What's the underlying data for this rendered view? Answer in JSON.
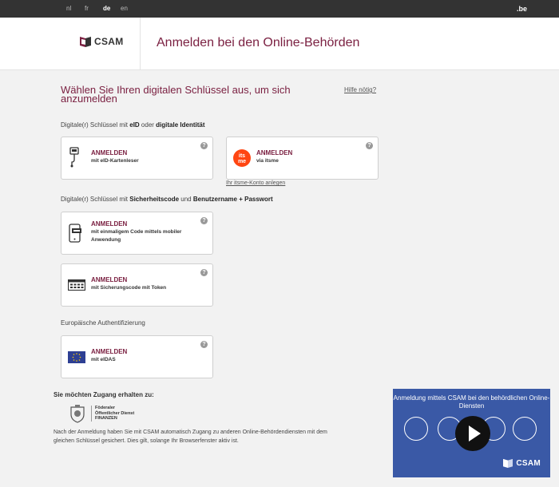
{
  "languages": [
    {
      "code": "nl",
      "active": false
    },
    {
      "code": "fr",
      "active": false
    },
    {
      "code": "de",
      "active": true
    },
    {
      "code": "en",
      "active": false
    }
  ],
  "domain_label": ".be",
  "header": {
    "logo_text": "CSAM",
    "title": "Anmelden bei den Online-Behörden"
  },
  "main": {
    "title": "Wählen Sie Ihren digitalen Schlüssel aus, um sich anzumelden",
    "help_link": "Hilfe nötig?"
  },
  "sections": {
    "s1": {
      "prefix": "Digitale(r) Schlüssel mit ",
      "b1": "eID",
      "mid": " oder ",
      "b2": "digitale Identität"
    },
    "s2": {
      "prefix": "Digitale(r) Schlüssel mit ",
      "b1": "Sicherheitscode",
      "mid": " und ",
      "b2": "Benutzername + Passwort"
    },
    "s3": {
      "label": "Europäische Authentifizierung"
    }
  },
  "cards": {
    "eid": {
      "title": "ANMELDEN",
      "subtitle": "mit eID-Kartenleser",
      "help": "?"
    },
    "itsme": {
      "title": "ANMELDEN",
      "subtitle": "via itsme",
      "help": "?",
      "badge_line1": "its",
      "badge_line2": "me"
    },
    "mobile": {
      "title": "ANMELDEN",
      "subtitle": "mit einmaligem Code mittels mobiler Anwendung",
      "help": "?"
    },
    "token": {
      "title": "ANMELDEN",
      "subtitle": "mit Sicherungscode mit Token",
      "help": "?"
    },
    "eidas": {
      "title": "ANMELDEN",
      "subtitle": "mit eIDAS",
      "help": "?"
    }
  },
  "itsme_link": "Ihr itsme-Konto anlegen",
  "access": {
    "title": "Sie möchten Zugang erhalten zu:",
    "org_line1": "Föderaler",
    "org_line2": "Öffentlicher Dienst",
    "org_line3": "FINANZEN",
    "description": "Nach der Anmeldung haben Sie mit CSAM automatisch Zugang zu anderen Online-Behördendiensten mit dem gleichen Schlüssel gesichert. Dies gilt, solange Ihr Browserfenster aktiv ist."
  },
  "video": {
    "title": "Anmeldung mittels CSAM bei den behördlichen Online-Diensten",
    "logo_text": "CSAM"
  },
  "colors": {
    "brand": "#7b2142",
    "topbar": "#333333",
    "video_bg": "#3a59a6",
    "itsme": "#ff4612",
    "eu_blue": "#2d3f93"
  }
}
